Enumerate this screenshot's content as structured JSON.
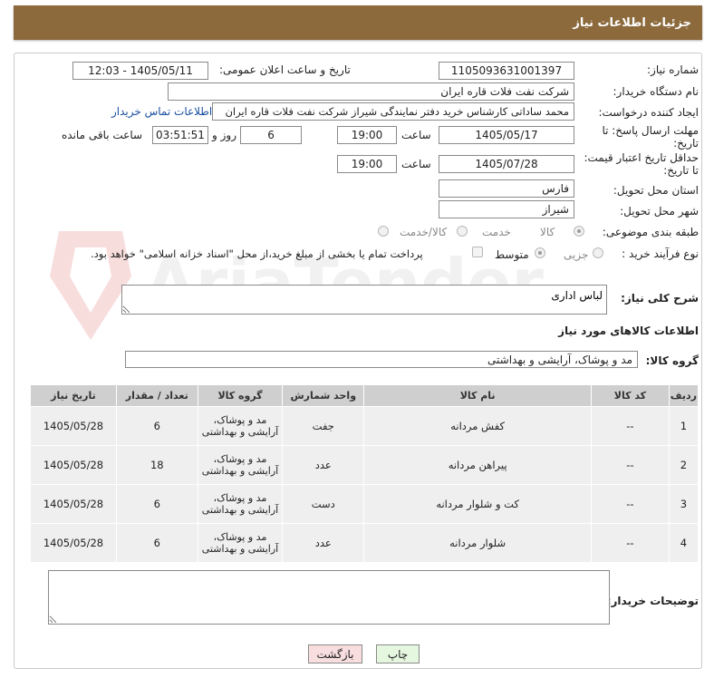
{
  "header": {
    "title": "جزئیات اطلاعات نیاز"
  },
  "form": {
    "need_number_label": "شماره نیاز:",
    "need_number": "1105093631001397",
    "announce_label": "تاریخ و ساعت اعلان عمومی:",
    "announce_value": "1405/05/11 - 12:03",
    "buyer_org_label": "نام دستگاه خریدار:",
    "buyer_org": "شرکت نفت فلات قاره ایران",
    "creator_label": "ایجاد کننده درخواست:",
    "creator": "محمد ساداتی کارشناس خرید دفتر نمایندگی شیراز شرکت نفت فلات قاره ایران",
    "contact_link": "اطلاعات تماس خریدار",
    "deadline_label_1": "مهلت ارسال پاسخ: تا",
    "deadline_label_2": "تاریخ:",
    "deadline_date": "1405/05/17",
    "time_label": "ساعت",
    "deadline_time": "19:00",
    "days_value": "6",
    "days_label": "روز و",
    "remaining_time": "03:51:51",
    "remaining_label": "ساعت باقی مانده",
    "validity_label_1": "حداقل تاریخ اعتبار قیمت:",
    "validity_label_2": "تا تاریخ:",
    "validity_date": "1405/07/28",
    "validity_time": "19:00",
    "province_label": "استان محل تحویل:",
    "province": "فارس",
    "city_label": "شهر محل تحویل:",
    "city": "شیراز",
    "category_label": "طبقه بندی موضوعی:",
    "category_options": [
      "کالا",
      "خدمت",
      "کالا/خدمت"
    ],
    "category_selected": "کالا",
    "process_label": "نوع فرآیند خرید :",
    "process_options": [
      "جزیی",
      "متوسط"
    ],
    "process_selected": "متوسط",
    "payment_note": "پرداخت تمام یا بخشی از مبلغ خرید،از محل \"اسناد خزانه اسلامی\" خواهد بود."
  },
  "description": {
    "label": "شرح کلی نیاز:",
    "value": "لباس اداری"
  },
  "goods": {
    "section_title": "اطلاعات کالاهای مورد نیاز",
    "group_label": "گروه کالا:",
    "group_value": "مد و پوشاک، آرایشی و بهداشتی",
    "columns": [
      "ردیف",
      "کد کالا",
      "نام کالا",
      "واحد شمارش",
      "گروه کالا",
      "تعداد / مقدار",
      "تاریخ نیاز"
    ],
    "rows": [
      {
        "idx": "1",
        "code": "--",
        "name": "کفش مردانه",
        "unit": "جفت",
        "group": "مد و پوشاک، آرایشی و بهداشتی",
        "qty": "6",
        "date": "1405/05/28"
      },
      {
        "idx": "2",
        "code": "--",
        "name": "پیراهن مردانه",
        "unit": "عدد",
        "group": "مد و پوشاک، آرایشی و بهداشتی",
        "qty": "18",
        "date": "1405/05/28"
      },
      {
        "idx": "3",
        "code": "--",
        "name": "کت و شلوار مردانه",
        "unit": "دست",
        "group": "مد و پوشاک، آرایشی و بهداشتی",
        "qty": "6",
        "date": "1405/05/28"
      },
      {
        "idx": "4",
        "code": "--",
        "name": "شلوار مردانه",
        "unit": "عدد",
        "group": "مد و پوشاک، آرایشی و بهداشتی",
        "qty": "6",
        "date": "1405/05/28"
      }
    ]
  },
  "buyer_notes": {
    "label": "توضیحات خریدار:",
    "value": ""
  },
  "buttons": {
    "print": "چاپ",
    "back": "بازگشت"
  },
  "watermark_text": "AriaTender.neT",
  "colors": {
    "header_bg": "#8c6a3c",
    "back_btn_bg": "#f8dede",
    "print_btn_bg": "#e6f7e0",
    "table_header_bg": "#cfcfcf"
  }
}
